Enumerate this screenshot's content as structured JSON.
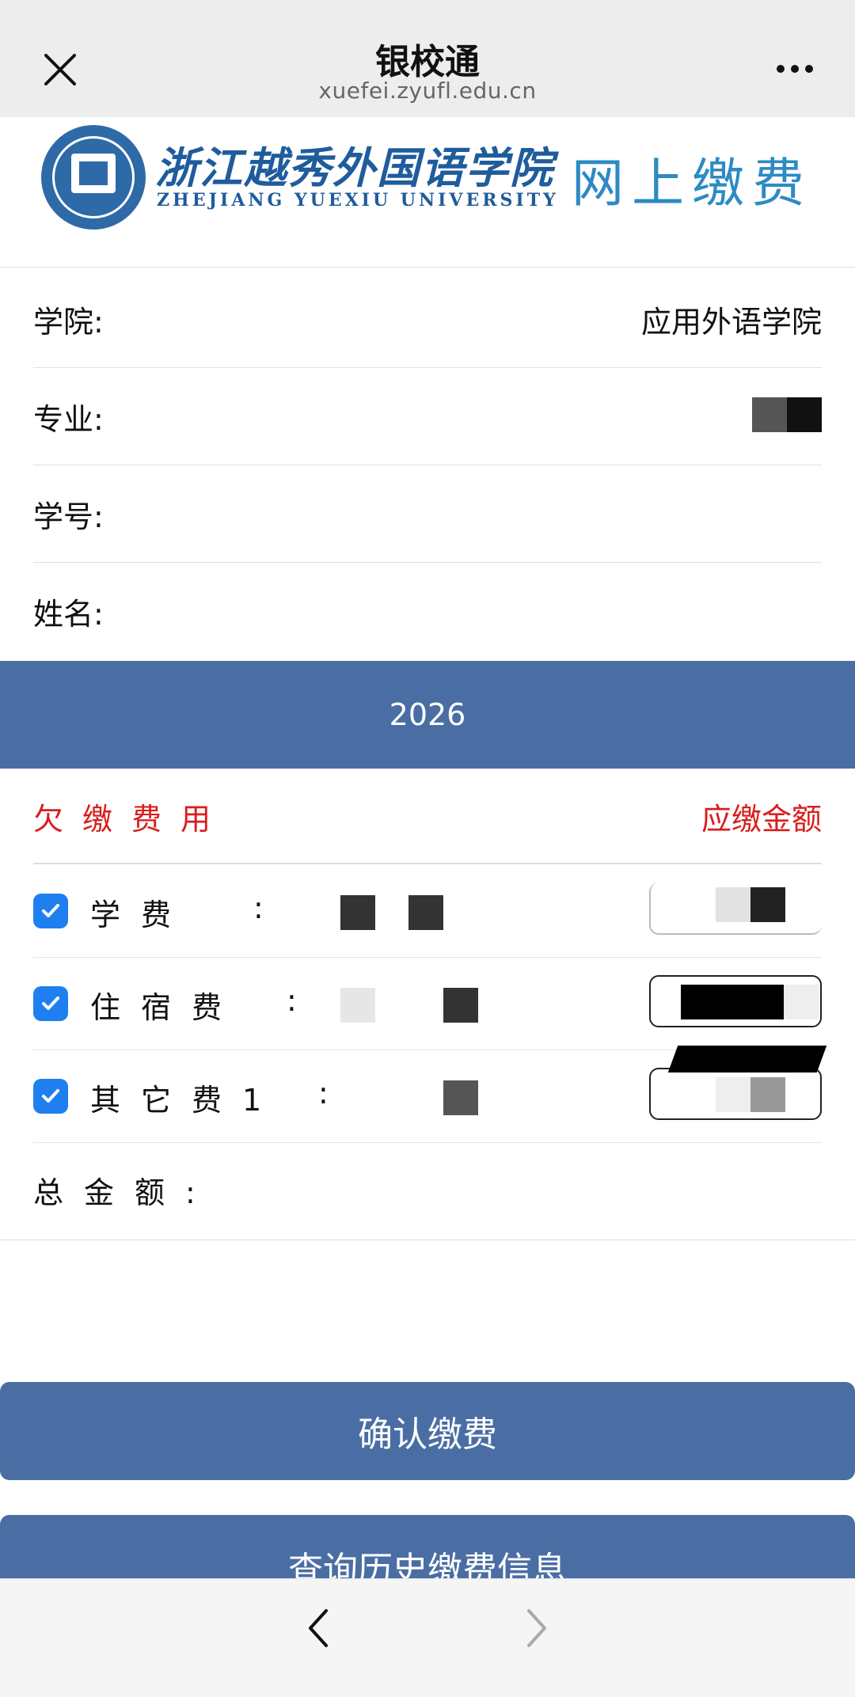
{
  "header": {
    "title": "银校通",
    "url": "xuefei.zyufl.edu.cn"
  },
  "banner": {
    "school_name_cn": "浙江越秀外国语学院",
    "school_name_en": "ZHEJIANG  YUEXIU  UNIVERSITY",
    "payment_title": "网上缴费"
  },
  "info": {
    "college_label": "学院:",
    "college_value": "应用外语学院",
    "major_label": "专业:",
    "student_id_label": "学号:",
    "name_label": "姓名:"
  },
  "year": "2026",
  "fees": {
    "header_left": "欠缴费用",
    "header_right": "应缴金额",
    "items": [
      {
        "label": "学费",
        "checked": true
      },
      {
        "label": "住宿费",
        "checked": true
      },
      {
        "label": "其它费1",
        "checked": true
      }
    ],
    "colon": ":",
    "total_label": "总金额:"
  },
  "buttons": {
    "confirm": "确认缴费",
    "history": "查询历史缴费信息"
  },
  "colors": {
    "primary": "#4a6ea3",
    "alert": "#d81e1e",
    "checkbox": "#1f7ff0"
  }
}
